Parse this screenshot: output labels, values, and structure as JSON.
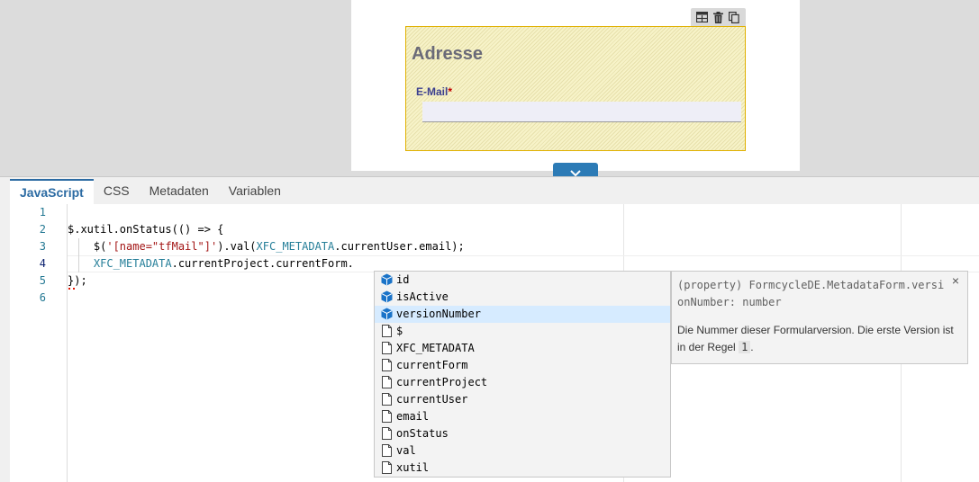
{
  "preview": {
    "fieldset_title": "Adresse",
    "email_label": "E-Mail",
    "required_mark": "*",
    "toolbar_icons": [
      "layout-icon",
      "trash-icon",
      "copy-icon"
    ]
  },
  "tabs": [
    {
      "label": "JavaScript",
      "active": true
    },
    {
      "label": "CSS",
      "active": false
    },
    {
      "label": "Metadaten",
      "active": false
    },
    {
      "label": "Variablen",
      "active": false
    }
  ],
  "editor": {
    "line_numbers": [
      "1",
      "2",
      "3",
      "4",
      "5",
      "6"
    ],
    "current_line": "4",
    "code": {
      "l2": "$.xutil.onStatus(() => {",
      "l3_pre": "    $(",
      "l3_str": "'[name=\"tfMail\"]'",
      "l3_mid": ").val(",
      "l3_ident": "XFC_METADATA",
      "l3_post": ".currentUser.email);",
      "l4_pre": "    ",
      "l4_ident": "XFC_METADATA",
      "l4_post": ".currentProject.currentForm.",
      "l5": "});"
    }
  },
  "suggestions": [
    {
      "label": "id",
      "kind": "property",
      "selected": false
    },
    {
      "label": "isActive",
      "kind": "property",
      "selected": false
    },
    {
      "label": "versionNumber",
      "kind": "property",
      "selected": true
    },
    {
      "label": "$",
      "kind": "text",
      "selected": false
    },
    {
      "label": "XFC_METADATA",
      "kind": "text",
      "selected": false
    },
    {
      "label": "currentForm",
      "kind": "text",
      "selected": false
    },
    {
      "label": "currentProject",
      "kind": "text",
      "selected": false
    },
    {
      "label": "currentUser",
      "kind": "text",
      "selected": false
    },
    {
      "label": "email",
      "kind": "text",
      "selected": false
    },
    {
      "label": "onStatus",
      "kind": "text",
      "selected": false
    },
    {
      "label": "val",
      "kind": "text",
      "selected": false
    },
    {
      "label": "xutil",
      "kind": "text",
      "selected": false
    }
  ],
  "details": {
    "signature": "(property) FormcycleDE.MetadataForm.versionNumber: number",
    "doc_text": "Die Nummer dieser Formularversion. Die erste Version ist in der Regel",
    "doc_code": "1",
    "doc_end": ".",
    "close": "×"
  },
  "colors": {
    "accent": "#2c6ba3",
    "collapse_button": "#2c7bb6",
    "property_icon": "#1a73c8",
    "selection": "#d6ebff"
  }
}
